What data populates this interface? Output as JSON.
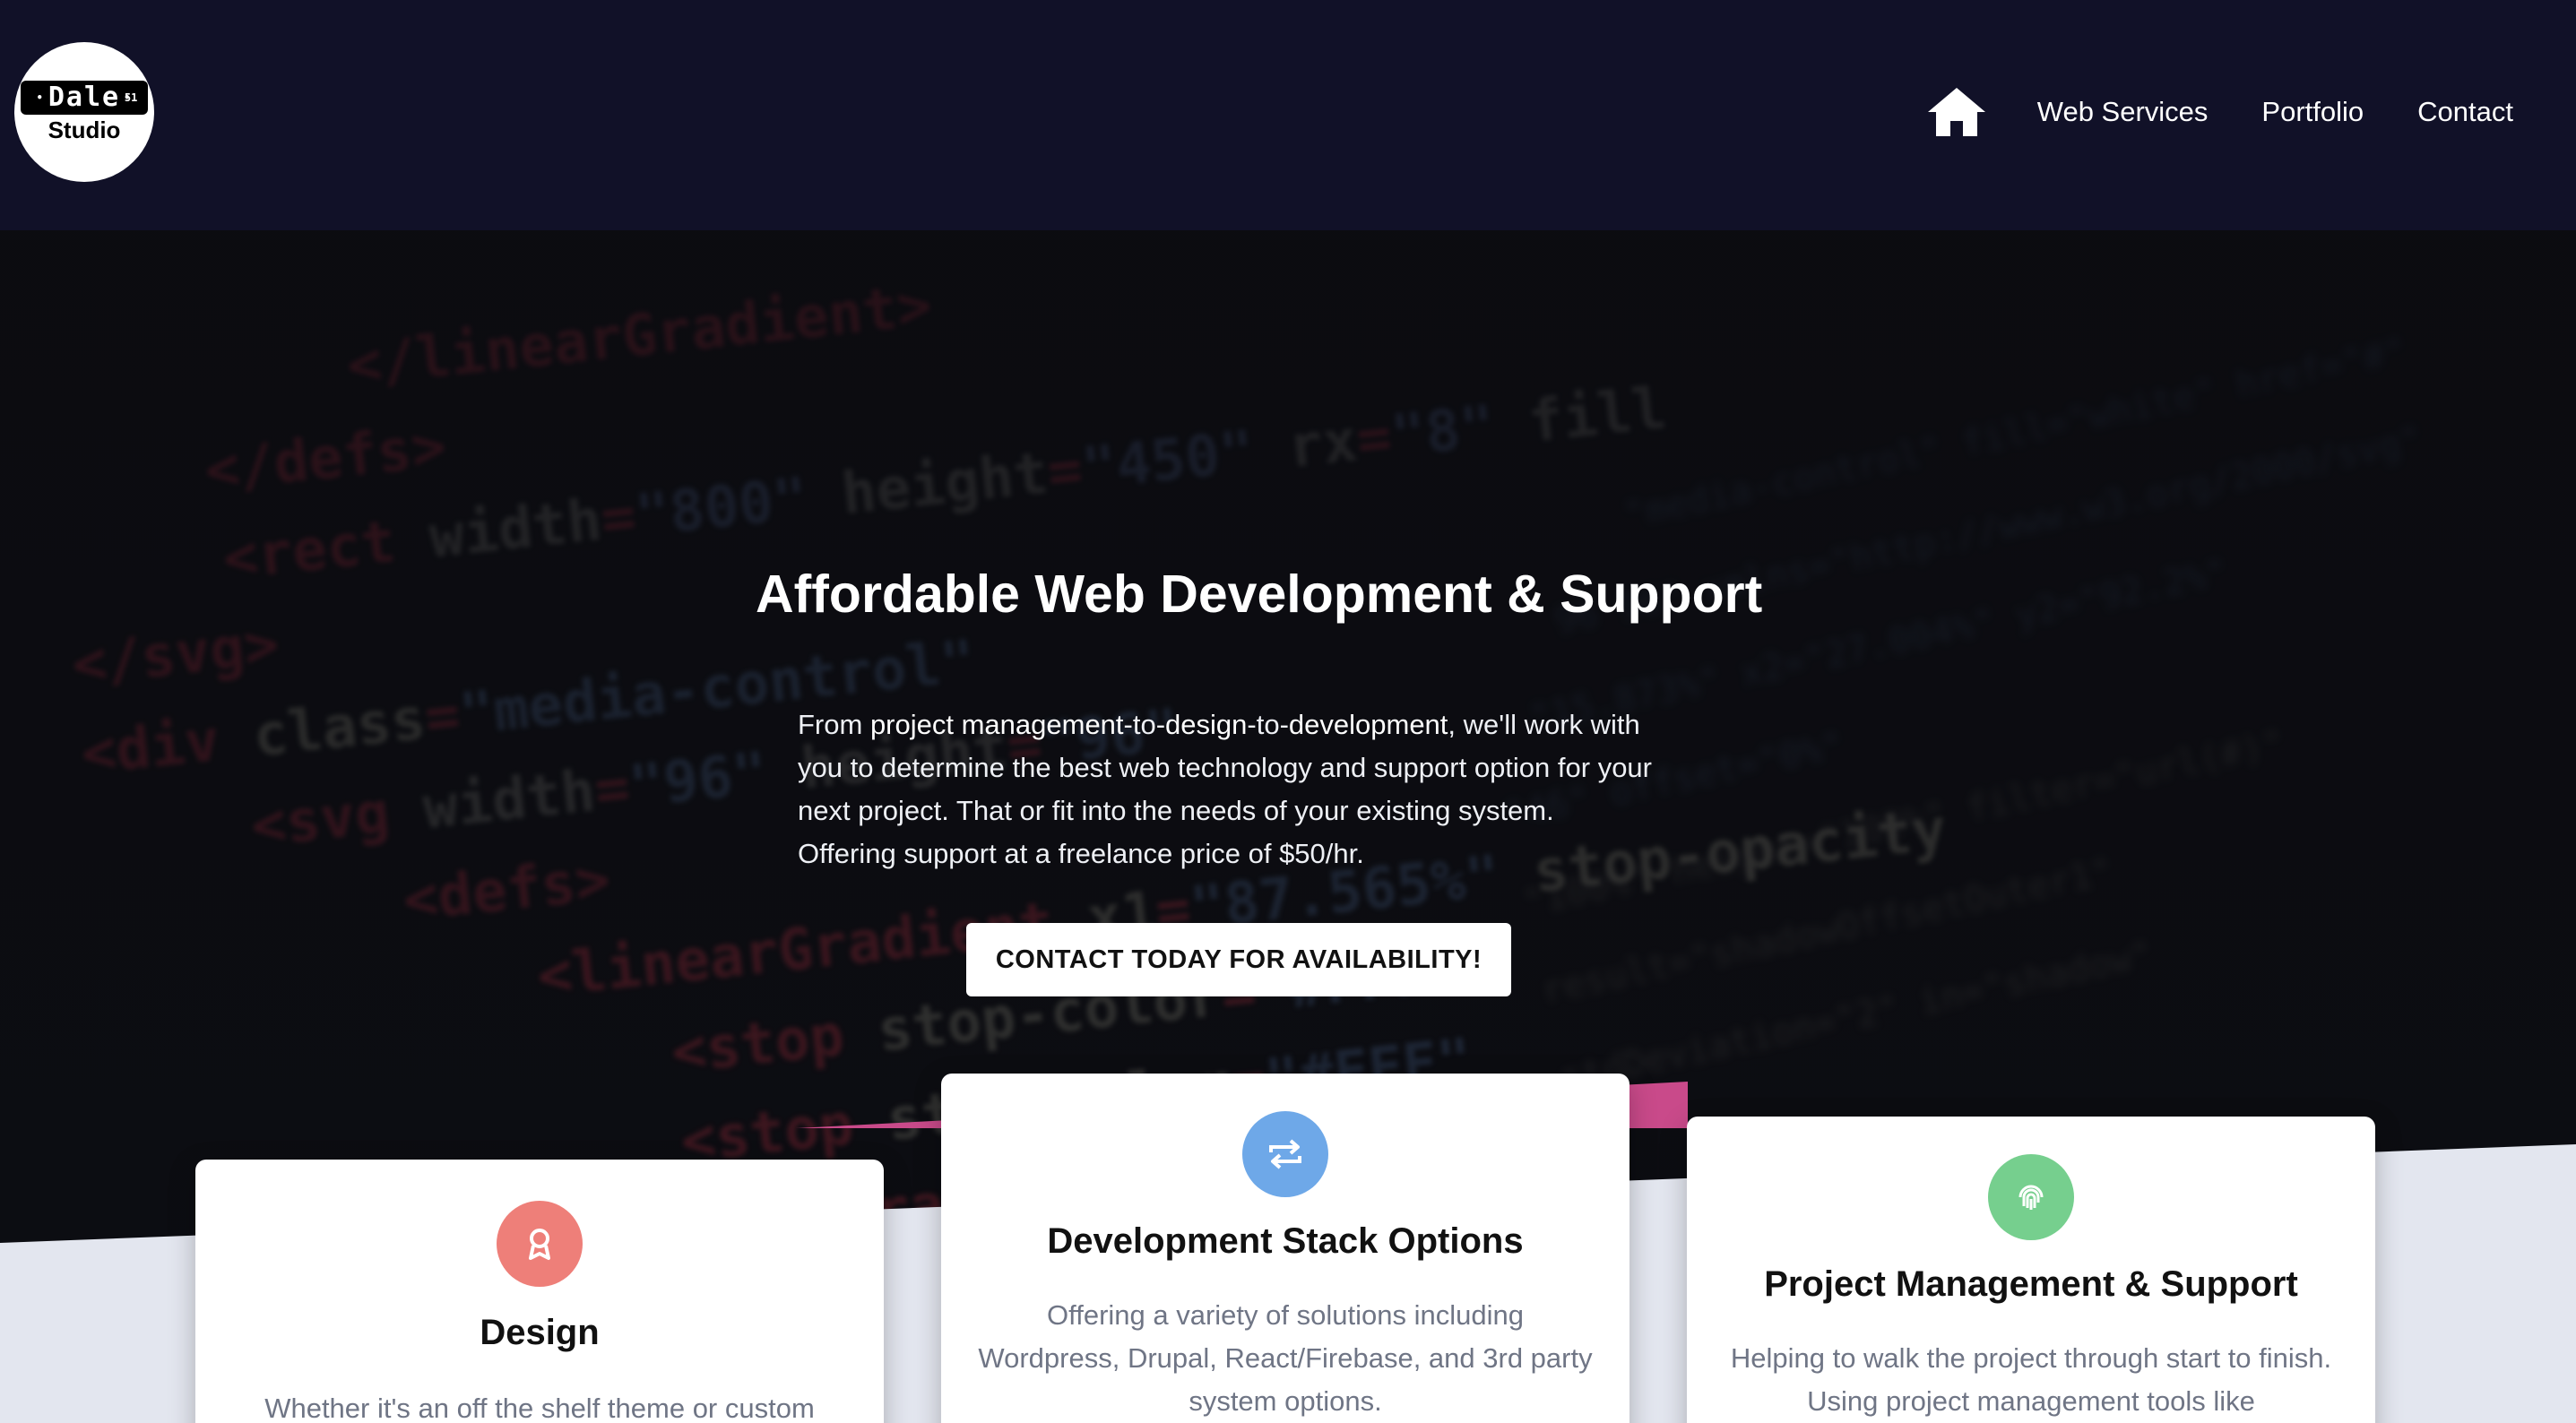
{
  "header": {
    "logo": {
      "line1": "Dale",
      "line2": "Studio",
      "superscript": "51"
    },
    "nav": {
      "home_icon": "home-icon",
      "items": [
        {
          "label": "Web Services"
        },
        {
          "label": "Portfolio"
        },
        {
          "label": "Contact"
        }
      ]
    }
  },
  "hero": {
    "title": "Affordable Web Development & Support",
    "description_parts": {
      "from": "From ",
      "project_management": "project management",
      "sep1": "-to-",
      "design": "design",
      "sep2": "-to-",
      "development": "development",
      "rest": ", we'll work with you to determine the best web technology and support option for your next project. That or fit into the needs of your existing system. Offering support at a freelance price of $50/hr."
    },
    "cta_label": "CONTACT TODAY FOR AVAILABILITY!",
    "accent_color": "#c94a8a"
  },
  "cards": [
    {
      "icon": "award-icon",
      "icon_color": "#ee7f79",
      "title": "Design",
      "text": "Whether it's an off the shelf theme or custom"
    },
    {
      "icon": "repeat-icon",
      "icon_color": "#6ea8e8",
      "title": "Development Stack Options",
      "text": "Offering a variety of solutions including Wordpress, Drupal, React/Firebase, and 3rd party system options."
    },
    {
      "icon": "fingerprint-icon",
      "icon_color": "#76cf8e",
      "title": "Project Management & Support",
      "text": "Helping to walk the project through start to finish. Using project management tools like"
    }
  ],
  "colors": {
    "header_bg": "#111128",
    "lower_section_bg": "#e3e6ef"
  }
}
